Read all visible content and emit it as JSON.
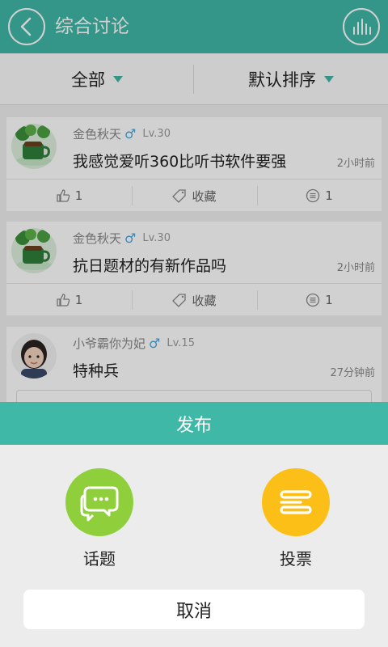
{
  "header": {
    "title": "综合讨论",
    "back_icon": "chevron-left-icon",
    "stats_icon": "bar-chart-icon"
  },
  "filters": {
    "category": "全部",
    "sort": "默认排序"
  },
  "posts": [
    {
      "username": "金色秋天",
      "gender": "♂",
      "level": "Lv.30",
      "title": "我感觉爱听360比听书软件要强",
      "time": "2小时前",
      "likes": "1",
      "favorite_label": "收藏",
      "comments": "1"
    },
    {
      "username": "金色秋天",
      "gender": "♂",
      "level": "Lv.30",
      "title": "抗日题材的有新作品吗",
      "time": "2小时前",
      "likes": "1",
      "favorite_label": "收藏",
      "comments": "1"
    },
    {
      "username": "小爷霸你为妃",
      "gender": "♂",
      "level": "Lv.15",
      "title": "特种兵",
      "time": "27分钟前"
    }
  ],
  "sheet": {
    "title": "发布",
    "options": [
      {
        "label": "话题",
        "icon": "chat-bubble-icon",
        "color": "#8fcf3c"
      },
      {
        "label": "投票",
        "icon": "vote-list-icon",
        "color": "#fcbf17"
      }
    ],
    "cancel_label": "取消"
  },
  "colors": {
    "accent": "#40b8a8",
    "male": "#4aa8e0"
  }
}
